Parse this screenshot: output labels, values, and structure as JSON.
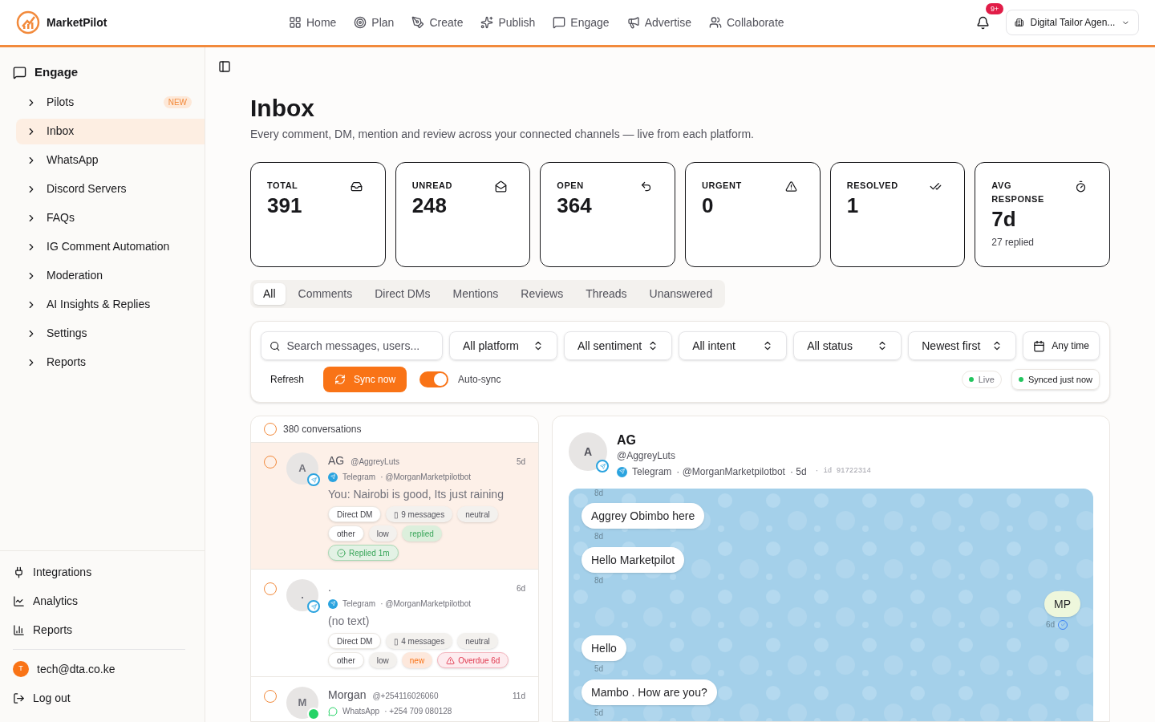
{
  "brand": "MarketPilot",
  "nav": [
    {
      "label": "Home",
      "selected": false
    },
    {
      "label": "Plan",
      "selected": false
    },
    {
      "label": "Create",
      "selected": false
    },
    {
      "label": "Publish",
      "selected": false
    },
    {
      "label": "Engage",
      "selected": false
    },
    {
      "label": "Advertise",
      "selected": false
    },
    {
      "label": "Collaborate",
      "selected": false
    }
  ],
  "notifications": {
    "badge": "9+"
  },
  "workspace": "Digital Tailor Agen...",
  "sidebar": {
    "section": "Engage",
    "items": [
      {
        "label": "Pilots",
        "selected": false,
        "badge": "NEW"
      },
      {
        "label": "Inbox",
        "selected": true
      },
      {
        "label": "WhatsApp",
        "selected": false
      },
      {
        "label": "Discord Servers",
        "selected": false
      },
      {
        "label": "FAQs",
        "selected": false
      },
      {
        "label": "IG Comment Automation",
        "selected": false
      },
      {
        "label": "Moderation",
        "selected": false
      },
      {
        "label": "AI Insights & Replies",
        "selected": false
      },
      {
        "label": "Settings",
        "selected": false
      },
      {
        "label": "Reports",
        "selected": false
      }
    ],
    "footer": [
      "Integrations",
      "Analytics",
      "Reports"
    ],
    "user": {
      "initial": "T",
      "email": "tech@dta.co.ke"
    },
    "logout": "Log out"
  },
  "page": {
    "title": "Inbox",
    "subtitle": "Every comment, DM, mention and review across your connected channels — live from each platform."
  },
  "stats": [
    {
      "label": "TOTAL",
      "value": "391"
    },
    {
      "label": "UNREAD",
      "value": "248"
    },
    {
      "label": "OPEN",
      "value": "364"
    },
    {
      "label": "URGENT",
      "value": "0"
    },
    {
      "label": "RESOLVED",
      "value": "1"
    },
    {
      "label": "AVG RESPONSE",
      "value": "7d",
      "note": "27 replied"
    }
  ],
  "tabs": [
    {
      "label": "All",
      "selected": true
    },
    {
      "label": "Comments",
      "selected": false
    },
    {
      "label": "Direct DMs",
      "selected": false
    },
    {
      "label": "Mentions",
      "selected": false
    },
    {
      "label": "Reviews",
      "selected": false
    },
    {
      "label": "Threads",
      "selected": false
    },
    {
      "label": "Unanswered",
      "selected": false
    }
  ],
  "filters": {
    "search": {
      "placeholder": "Search messages, users..."
    },
    "selects": [
      "All platform",
      "All sentiment",
      "All intent",
      "All status",
      "Newest first"
    ],
    "date": "Any time",
    "refresh": "Refresh",
    "sync": "Sync now",
    "autosync": {
      "label": "Auto-sync",
      "on": true
    },
    "live": "Live",
    "synced": "Synced just now"
  },
  "list": {
    "count": "380 conversations",
    "all_checked": false,
    "conversations": [
      {
        "initial": "A",
        "name": "AG",
        "handle": "@AggreyLuts",
        "time": "5d",
        "platform": {
          "kind": "telegram",
          "label": "Telegram"
        },
        "account": "· @MorganMarketpilotbot",
        "preview": "You: Nairobi is good, Its just raining",
        "selected": true,
        "checked": false,
        "tags": [
          [
            {
              "text": "Direct DM",
              "kind": "outline"
            },
            {
              "text": "▯ 9 messages",
              "kind": "muted"
            },
            {
              "text": "neutral",
              "kind": "muted"
            }
          ],
          [
            {
              "text": "other",
              "kind": "outline"
            },
            {
              "text": "low",
              "kind": "muted"
            },
            {
              "text": "replied",
              "kind": "success"
            }
          ],
          [
            {
              "text": "Replied 1m",
              "kind": "done"
            }
          ]
        ]
      },
      {
        "initial": ".",
        "name": ".",
        "time": "6d",
        "platform": {
          "kind": "telegram",
          "label": "Telegram"
        },
        "account": "· @MorganMarketpilotbot",
        "preview": "(no text)",
        "selected": false,
        "checked": false,
        "tags": [
          [
            {
              "text": "Direct DM",
              "kind": "outline"
            },
            {
              "text": "▯ 4 messages",
              "kind": "muted"
            },
            {
              "text": "neutral",
              "kind": "muted"
            }
          ],
          [
            {
              "text": "other",
              "kind": "outline"
            },
            {
              "text": "low",
              "kind": "muted"
            },
            {
              "text": "new",
              "kind": "warning"
            },
            {
              "text": "Overdue 6d",
              "kind": "danger"
            }
          ]
        ]
      },
      {
        "initial": "M",
        "name": "Morgan",
        "handle": "@+254116026060",
        "time": "11d",
        "platform": {
          "kind": "whatsapp",
          "label": "WhatsApp"
        },
        "account": "· +254 709 080128",
        "selected": false,
        "checked": false
      }
    ]
  },
  "thread": {
    "initial": "A",
    "name": "AG",
    "handle": "@AggreyLuts",
    "platform": {
      "kind": "telegram",
      "label": "Telegram"
    },
    "account": "· @MorganMarketpilotbot",
    "age": "· 5d",
    "id": "· id 91722314",
    "leading_time": "8d",
    "messages": [
      {
        "text": "Aggrey Obimbo here",
        "kind": "incoming",
        "time": "8d"
      },
      {
        "text": "Hello Marketpilot",
        "kind": "incoming",
        "time": "8d"
      },
      {
        "text": "MP",
        "kind": "outgoing",
        "time": "6d"
      },
      {
        "text": "Hello",
        "kind": "incoming",
        "time": "5d"
      },
      {
        "text": "Mambo . How are you?",
        "kind": "incoming",
        "time": "5d"
      }
    ]
  }
}
